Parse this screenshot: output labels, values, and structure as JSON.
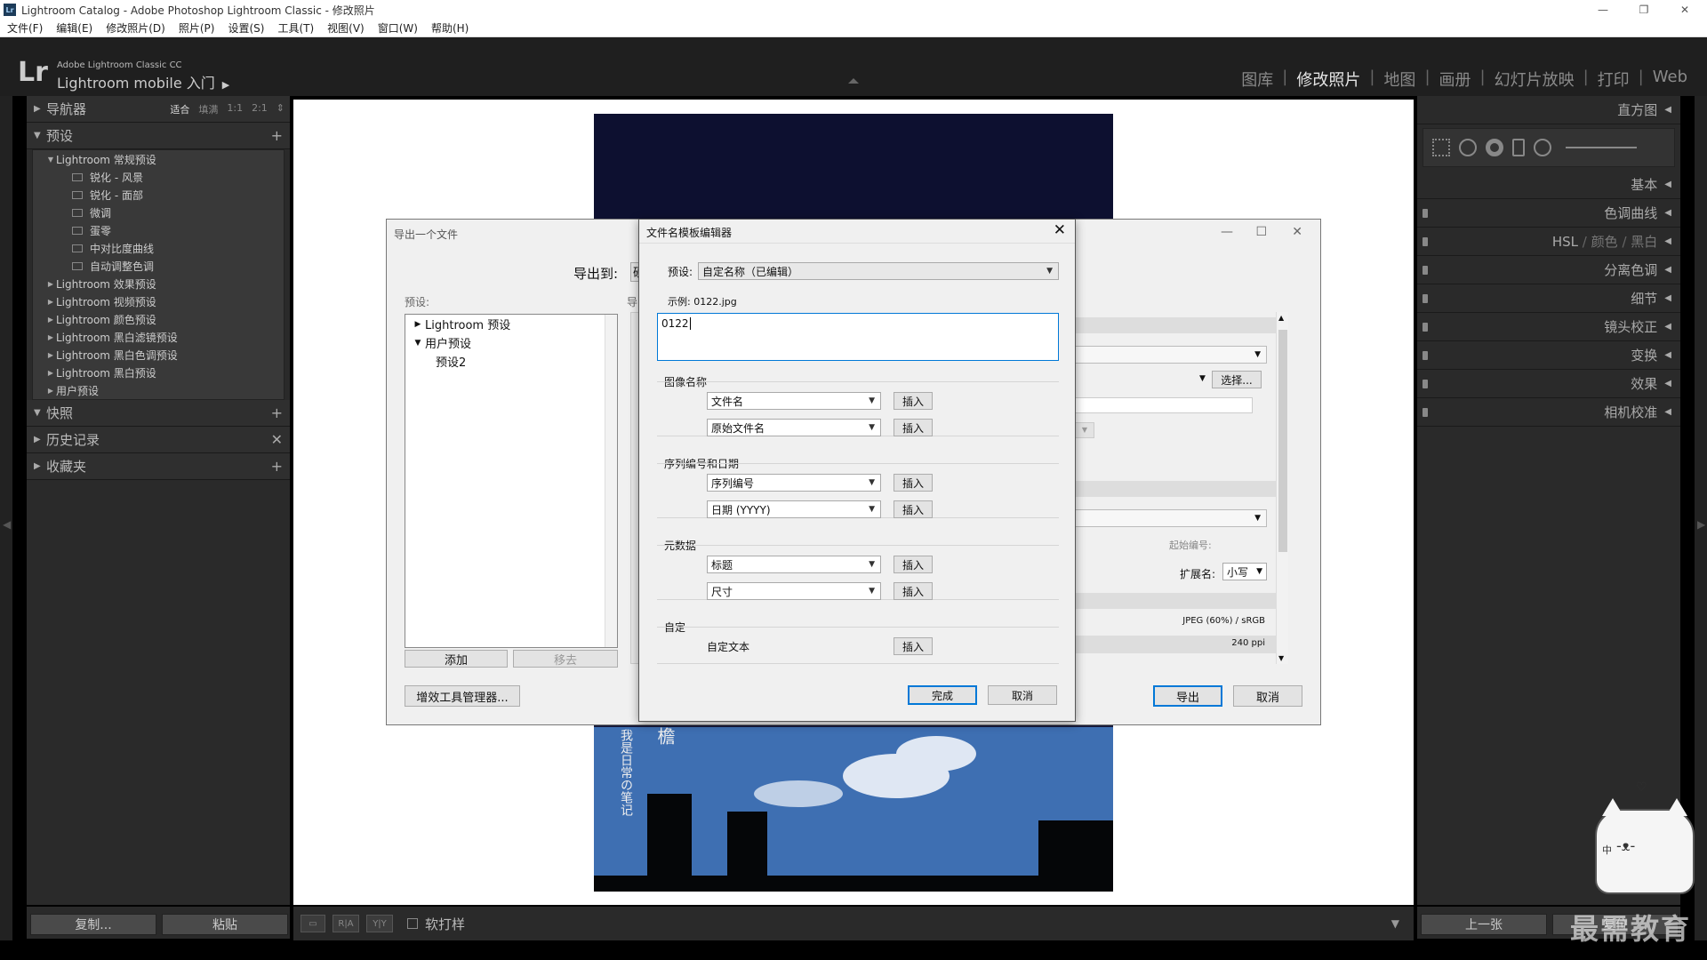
{
  "window": {
    "title": "Lightroom Catalog - Adobe Photoshop Lightroom Classic - 修改照片",
    "app_icon": "Lr"
  },
  "menu": [
    "文件(F)",
    "编辑(E)",
    "修改照片(D)",
    "照片(P)",
    "设置(S)",
    "工具(T)",
    "视图(V)",
    "窗口(W)",
    "帮助(H)"
  ],
  "lr_header": {
    "logo": "Lr",
    "product": "Adobe Lightroom Classic CC",
    "mobile": "Lightroom mobile 入门",
    "arrow": "▶",
    "modules": [
      "图库",
      "修改照片",
      "地图",
      "画册",
      "幻灯片放映",
      "打印",
      "Web"
    ],
    "active_module": "修改照片"
  },
  "left_panel": {
    "navigator": {
      "label": "导航器",
      "options": [
        "适合",
        "填满",
        "1:1",
        "2:1"
      ]
    },
    "presets": {
      "label": "预设",
      "groups": [
        {
          "label": "Lightroom 常规预设",
          "expanded": true,
          "items": [
            "锐化 - 风景",
            "锐化 - 面部",
            "微调",
            "蛋零",
            "中对比度曲线",
            "自动调整色调"
          ]
        },
        {
          "label": "Lightroom 效果预设"
        },
        {
          "label": "Lightroom 视频预设"
        },
        {
          "label": "Lightroom 颜色预设"
        },
        {
          "label": "Lightroom 黑白滤镜预设"
        },
        {
          "label": "Lightroom 黑白色调预设"
        },
        {
          "label": "Lightroom 黑白预设"
        },
        {
          "label": "用户预设"
        }
      ]
    },
    "snapshots": "快照",
    "history": "历史记录",
    "collections": "收藏夹",
    "copy_btn": "复制...",
    "paste_btn": "粘贴"
  },
  "toolbar": {
    "proof_label": "软打样",
    "view_icons": [
      "R|A",
      "Y|Y"
    ]
  },
  "right_panel": {
    "histogram": "直方图",
    "sections": [
      "基本",
      "色调曲线",
      "分离色调",
      "细节",
      "镜头校正",
      "变换",
      "效果",
      "相机校准"
    ],
    "hsl": [
      "HSL",
      "/",
      "颜色",
      "/",
      "黑白"
    ],
    "prev_btn": "上一张",
    "reset_btn": "复位"
  },
  "export_dialog": {
    "title": "导出一个文件",
    "export_to_label": "导出到:",
    "export_to_value": "硬",
    "presets_label": "预设:",
    "side_label": "导",
    "tree": [
      {
        "label": "Lightroom 预设",
        "expanded": false,
        "level": 0
      },
      {
        "label": "用户预设",
        "expanded": true,
        "level": 0
      },
      {
        "label": "预设2",
        "level": 1
      }
    ],
    "add_btn": "添加",
    "remove_btn": "移去",
    "plugin_btn": "增效工具管理器...",
    "choose_btn": "选择...",
    "start_number_label": "起始编号:",
    "extension_label": "扩展名:",
    "extension_value": "小写",
    "format_value": "JPEG (60%) / sRGB",
    "resolution_value": "240 ppi",
    "export_btn": "导出",
    "cancel_btn": "取消"
  },
  "template_editor": {
    "title": "文件名模板编辑器",
    "preset_label": "预设:",
    "preset_value": "自定名称（已编辑）",
    "example_label": "示例: 0122.jpg",
    "template_text": "0122",
    "groups": [
      {
        "label": "图像名称",
        "rows": [
          "文件名",
          "原始文件名"
        ]
      },
      {
        "label": "序列编号和日期",
        "rows": [
          "序列编号",
          "日期 (YYYY)"
        ]
      },
      {
        "label": "元数据",
        "rows": [
          "标题",
          "尺寸"
        ]
      }
    ],
    "custom_label": "自定",
    "custom_text_label": "自定文本",
    "insert_btn": "插入",
    "done_btn": "完成",
    "cancel_btn": "取消"
  },
  "photo": {
    "vertical_text": "我是日常の笔记",
    "title_char": "檐"
  },
  "overlay": {
    "watermark": "最需教育",
    "ime": "中"
  }
}
